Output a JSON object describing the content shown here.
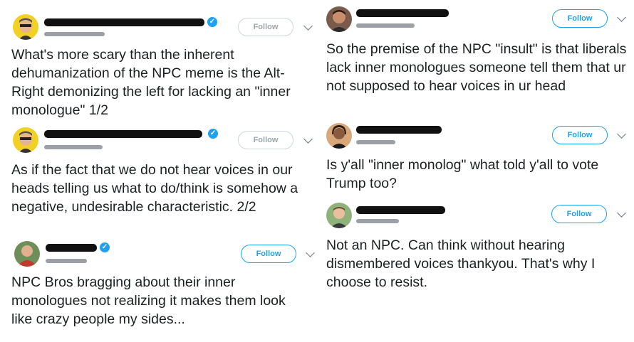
{
  "tweets": [
    {
      "follow_label": "Follow",
      "text": "What's more scary than the inherent dehumanization of the NPC meme is the Alt-Right demonizing the left for lacking an \"inner monologue\" 1/2",
      "verified": true,
      "button_style": "gray",
      "chevron_icon": "chevron-down-icon"
    },
    {
      "follow_label": "Follow",
      "text": "As if the fact that we do not hear voices in our heads telling us what to do/think is somehow a negative, undesirable characteristic. 2/2",
      "verified": true,
      "button_style": "gray",
      "chevron_icon": "chevron-down-icon"
    },
    {
      "follow_label": "Follow",
      "text": "NPC Bros bragging about their inner monologues not realizing it makes them look like crazy people my sides...",
      "verified": true,
      "button_style": "blue",
      "chevron_icon": "chevron-down-icon"
    },
    {
      "follow_label": "Follow",
      "text": "So the premise of the NPC \"insult\" is that liberals lack inner monologues someone tell them that ur not supposed to hear voices in ur head",
      "verified": false,
      "button_style": "blue",
      "chevron_icon": "chevron-down-icon"
    },
    {
      "follow_label": "Follow",
      "text": "Is y'all \"inner monolog\" what told y'all to vote Trump too?",
      "verified": false,
      "button_style": "blue",
      "chevron_icon": "chevron-down-icon"
    },
    {
      "follow_label": "Follow",
      "text": "Not an NPC. Can think without hearing dismembered voices thankyou. That's why I choose to resist.",
      "verified": false,
      "button_style": "blue",
      "chevron_icon": "chevron-down-icon"
    }
  ],
  "colors": {
    "twitter_blue": "#1da1f2",
    "gray_border": "#ccd6dd",
    "text": "#1c2022"
  }
}
